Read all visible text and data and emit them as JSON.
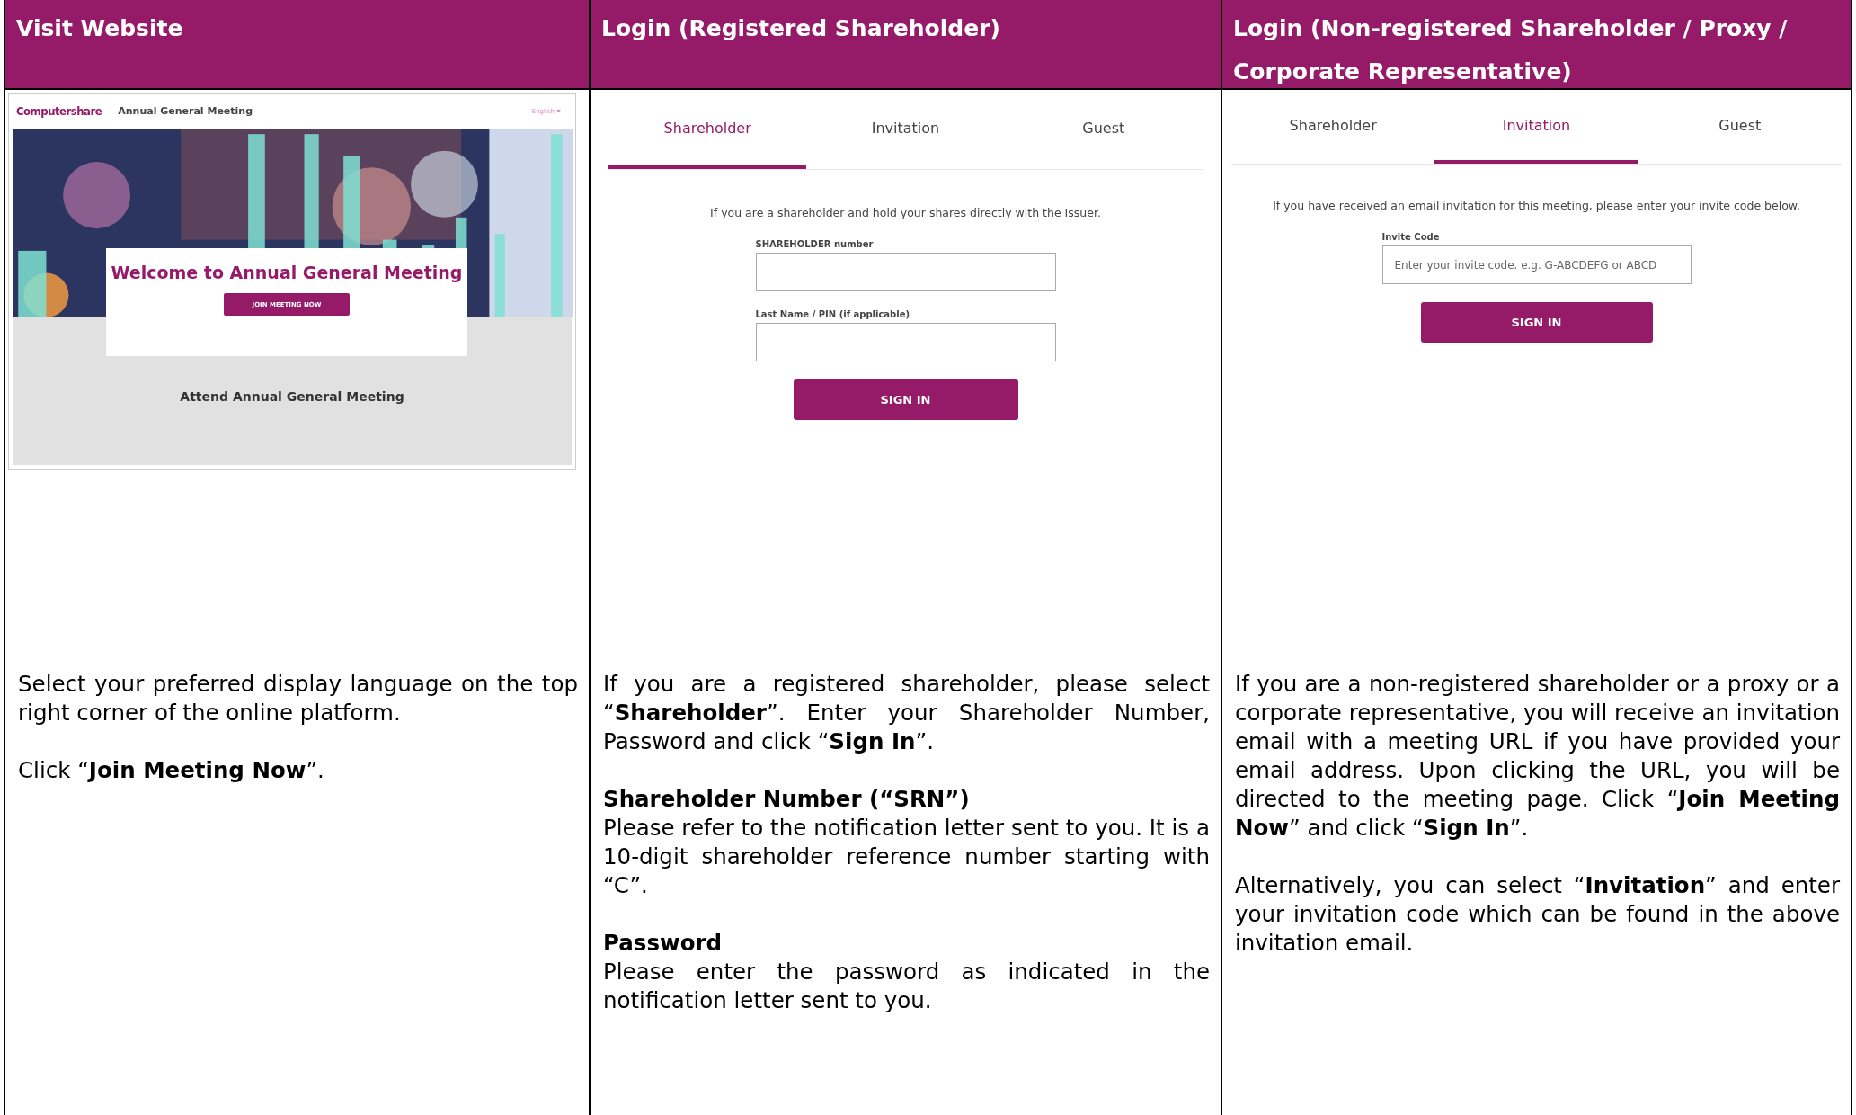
{
  "columns": [
    {
      "heading": "Visit Website",
      "screen": {
        "kind": "website",
        "logo": "Computershare",
        "title": "Annual General Meeting",
        "language": "English",
        "hero_title": "Welcome to Annual General Meeting",
        "button": "JOIN MEETING NOW",
        "footer_text": "Attend Annual General Meeting"
      },
      "paragraphs": [
        {
          "kind": "text",
          "text": "Select your preferred display language on the top right corner of the online platform."
        },
        {
          "kind": "text",
          "text": "Click “**Join Meeting Now**”."
        }
      ]
    },
    {
      "heading": "Login (Registered Shareholder)",
      "screen": {
        "kind": "login",
        "tabs": [
          {
            "label": "Shareholder",
            "selected": true
          },
          {
            "label": "Invitation",
            "selected": false
          },
          {
            "label": "Guest",
            "selected": false
          }
        ],
        "intro": "If you are a shareholder and hold your shares directly with the Issuer.",
        "fields": [
          {
            "label": "SHAREHOLDER number"
          },
          {
            "label": "Last Name / PIN (if applicable)"
          }
        ],
        "button": "SIGN IN"
      },
      "paragraphs": [
        {
          "kind": "text",
          "text": "If you are a registered shareholder, please select “**Shareholder**”. Enter your Shareholder Number, Password and click “**Sign In**”."
        },
        {
          "kind": "heading",
          "text": "Shareholder Number (“SRN”)"
        },
        {
          "kind": "text",
          "text": "Please refer to the notification letter sent to you. It is a 10-digit shareholder reference number starting with “C”."
        },
        {
          "kind": "heading",
          "text": "Password"
        },
        {
          "kind": "text",
          "text": "Please enter the password as indicated in the notification letter sent to you."
        }
      ]
    },
    {
      "heading": "Login (Non-registered Shareholder / Proxy / Corporate Representative)",
      "screen": {
        "kind": "login",
        "tabs": [
          {
            "label": "Shareholder",
            "selected": false
          },
          {
            "label": "Invitation",
            "selected": true
          },
          {
            "label": "Guest",
            "selected": false
          }
        ],
        "intro": "If you have received an email invitation for this meeting, please enter your invite code below.",
        "fields": [
          {
            "label": "Invite Code",
            "placeholder": "Enter your invite code. e.g. G-ABCDEFG or ABCD"
          }
        ],
        "button": "SIGN IN"
      },
      "paragraphs": [
        {
          "kind": "text",
          "text": "If you are a non-registered shareholder or a proxy or a corporate representative, you will receive an invitation email with a meeting URL if you have provided your email address. Upon clicking the URL, you will be directed to the meeting page. Click “**Join Meeting Now**” and click “**Sign In**”."
        },
        {
          "kind": "text",
          "text": "Alternatively, you can select “**Invitation**” and enter your invitation code which can be found in the above invitation email."
        }
      ]
    }
  ]
}
